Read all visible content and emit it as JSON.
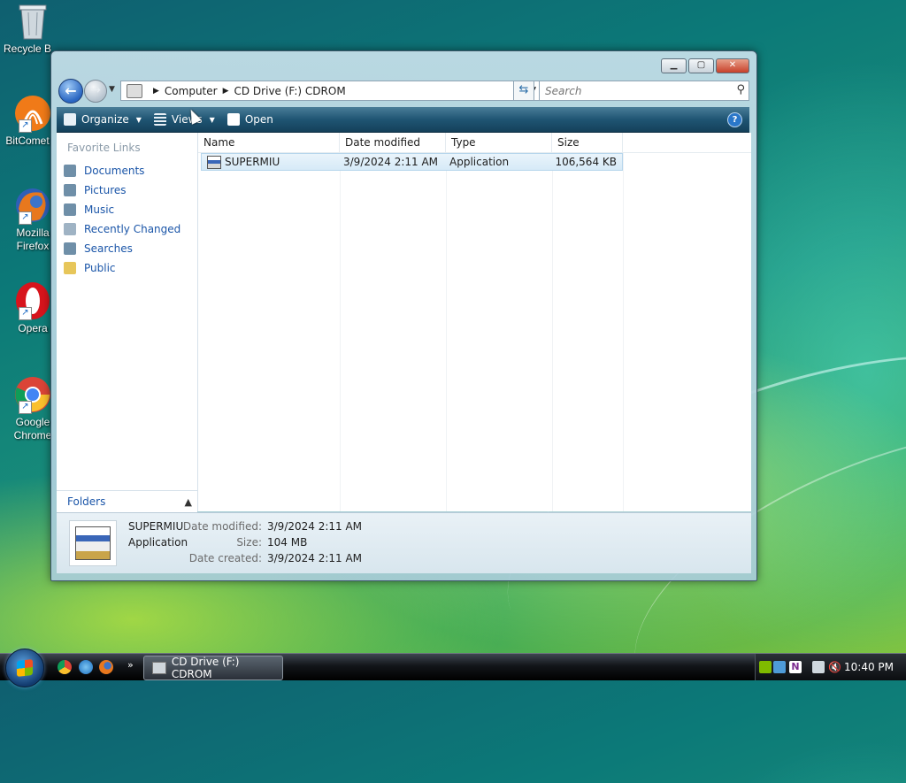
{
  "desktop": {
    "icons": [
      {
        "label": "Recycle Bin",
        "icon": "recycle-bin-icon"
      },
      {
        "label": "BitComet",
        "icon": "bitcomet-icon"
      },
      {
        "label": "Mozilla Firefox",
        "icon": "firefox-icon"
      },
      {
        "label": "Opera",
        "icon": "opera-icon"
      },
      {
        "label": "Google Chrome",
        "icon": "chrome-icon"
      }
    ]
  },
  "window": {
    "address": {
      "crumbs": [
        "Computer",
        "CD Drive (F:) CDROM"
      ]
    },
    "search": {
      "placeholder": "Search"
    },
    "toolbar": {
      "organize": "Organize",
      "views": "Views",
      "open": "Open"
    },
    "nav": {
      "header": "Favorite Links",
      "links": [
        "Documents",
        "Pictures",
        "Music",
        "Recently Changed",
        "Searches",
        "Public"
      ],
      "folders_label": "Folders"
    },
    "columns": [
      "Name",
      "Date modified",
      "Type",
      "Size"
    ],
    "files": [
      {
        "name": "SUPERMIU",
        "date": "3/9/2024 2:11 AM",
        "type": "Application",
        "size": "106,564 KB"
      }
    ],
    "details": {
      "name": "SUPERMIU",
      "type": "Application",
      "date_modified_label": "Date modified:",
      "date_modified": "3/9/2024 2:11 AM",
      "size_label": "Size:",
      "size": "104 MB",
      "date_created_label": "Date created:",
      "date_created": "3/9/2024 2:11 AM"
    }
  },
  "taskbar": {
    "active_task": "CD Drive (F:) CDROM",
    "more": "»",
    "clock": "10:40 PM"
  },
  "colors": {
    "accent": "#1a55a8",
    "toolbar": "#1f5573",
    "selection": "#d6eaf7"
  }
}
